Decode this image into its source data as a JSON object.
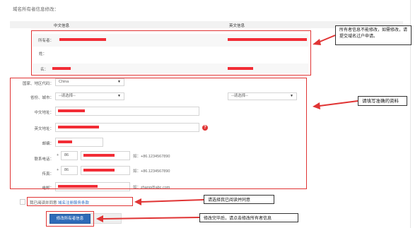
{
  "page": {
    "title": "域名所有者信息修改："
  },
  "table_headers": {
    "chinese": "中文信息",
    "english": "英文信息"
  },
  "owner_fields": {
    "owner_label": "所有者：",
    "surname_label": "姓：",
    "name_label": "名："
  },
  "form": {
    "country_label": "国家、地区代码：",
    "country_value": "China",
    "province_label": "省份、城市：",
    "province_placeholder": "--请选择--",
    "city_placeholder": "--请选择--",
    "cn_address_label": "中文地址：",
    "en_address_label": "英文地址：",
    "postcode_label": "邮编：",
    "phone_label": "联系电话：",
    "phone_prefix": "+",
    "phone_code": "86",
    "phone_hint": "如：+86.1234567890",
    "fax_label": "传真：",
    "fax_prefix": "+",
    "fax_code": "86",
    "fax_hint": "如：+86.1234567890",
    "email_label": "电邮：",
    "email_hint": "如：zhang@abc.com",
    "help_icon_text": "?"
  },
  "agreement": {
    "text": "我已阅读并同意",
    "link": "域名注册服务条款"
  },
  "buttons": {
    "submit": "修改所有者信息"
  },
  "annotations": {
    "owner_note": "所有者信息不能修改，如需修改，请提交域名过户申请。",
    "fill_note": "请填写准确的资料",
    "agree_note": "请选择我已阅读并同意",
    "submit_note": "修改完毕后，请点击修改所有者信息"
  }
}
